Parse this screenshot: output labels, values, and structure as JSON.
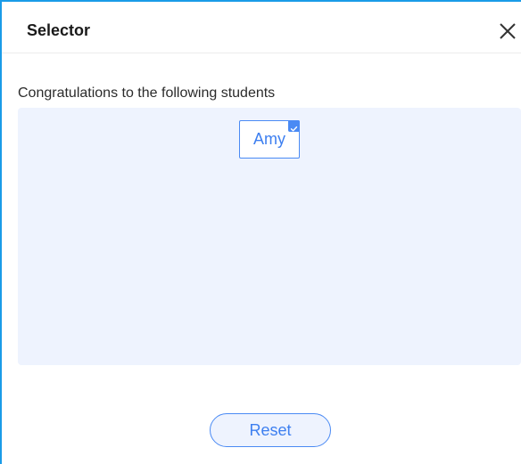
{
  "window": {
    "title": "Selector",
    "close_icon": "close-icon"
  },
  "content": {
    "subtitle": "Congratulations to the following students",
    "selected_students": [
      {
        "name": "Amy",
        "checked": true
      }
    ]
  },
  "actions": {
    "reset_label": "Reset"
  },
  "colors": {
    "accent": "#4a8af4",
    "border": "#1a9be8",
    "panel_bg": "#eef3fe",
    "title_text": "#1a1a1a"
  }
}
